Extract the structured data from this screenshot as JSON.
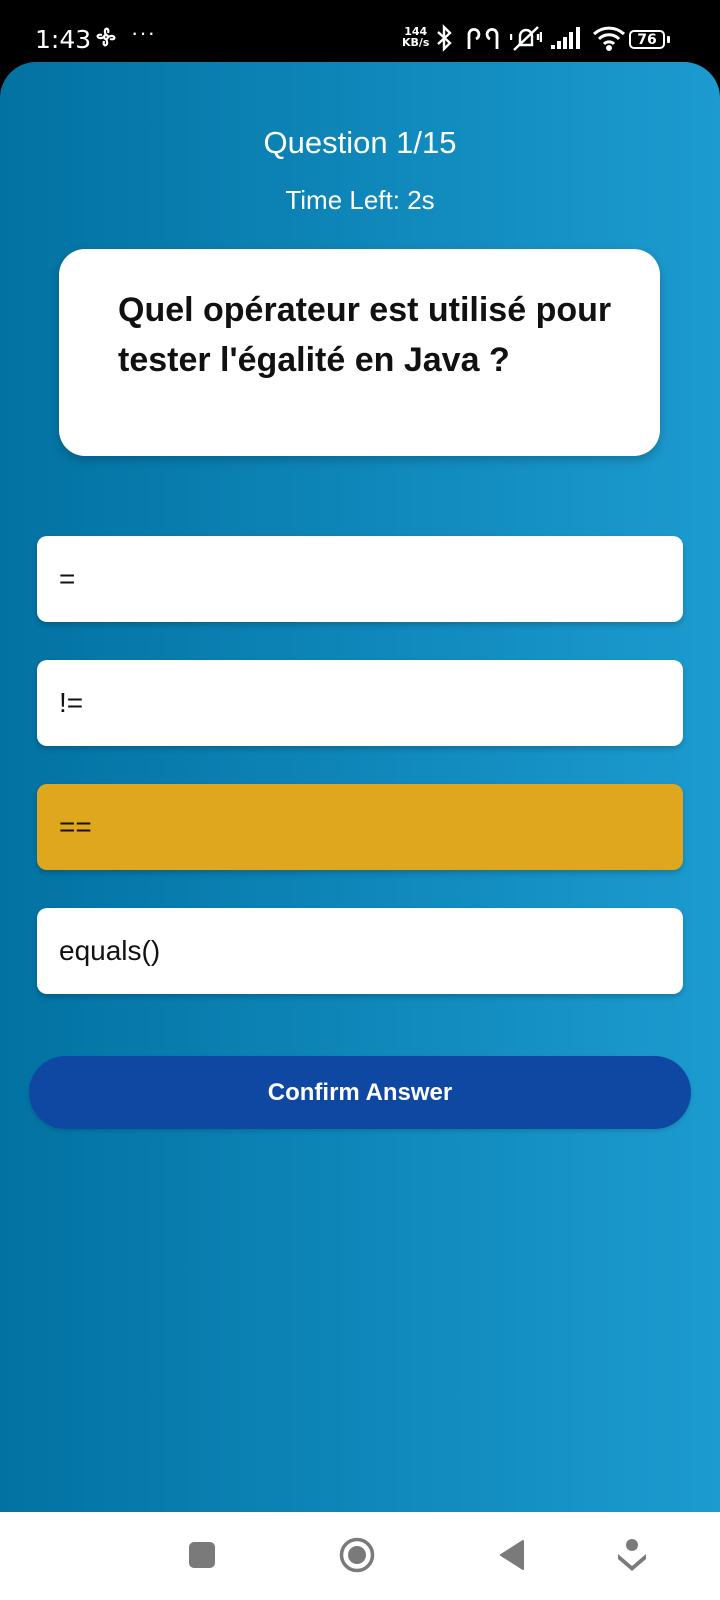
{
  "status_bar": {
    "time": "1:43",
    "more": "···",
    "speed_value": "144",
    "speed_unit": "KB/s",
    "battery": "76",
    "icons": [
      "fan-icon",
      "bluetooth-icon",
      "earbuds-icon",
      "vibrate-silent-icon",
      "signal-icon",
      "wifi-icon",
      "battery-icon"
    ]
  },
  "quiz": {
    "counter": "Question 1/15",
    "time_left": "Time Left: 2s",
    "question": "Quel opérateur est utilisé pour tester l'égalité en Java ?",
    "options": [
      "=",
      "!=",
      "==",
      "equals()"
    ],
    "selected_index": 2,
    "confirm_label": "Confirm Answer"
  },
  "nav_bar": {
    "icons": [
      "recents-square-icon",
      "home-circle-icon",
      "back-triangle-icon",
      "assistant-icon"
    ]
  },
  "colors": {
    "gradient_start": "#0272a2",
    "gradient_end": "#1c9bd0",
    "selected_option": "#dfa71d",
    "confirm_button": "#0f48a3"
  }
}
